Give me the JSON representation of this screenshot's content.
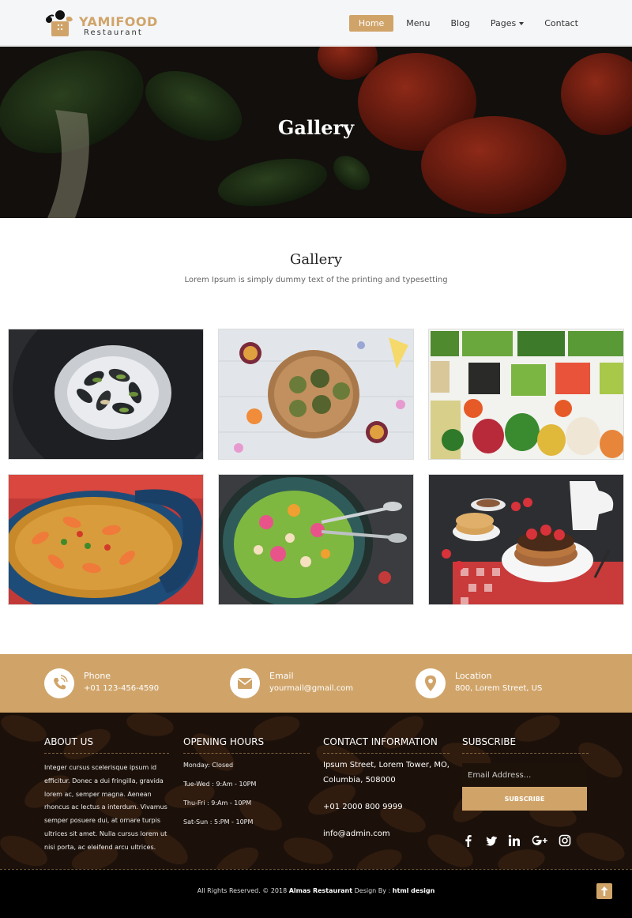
{
  "brand": {
    "name": "YAMIFOOD",
    "tagline": "Restaurant"
  },
  "nav": {
    "items": [
      {
        "label": "Home",
        "active": true
      },
      {
        "label": "Menu"
      },
      {
        "label": "Blog"
      },
      {
        "label": "Pages",
        "dropdown": true
      },
      {
        "label": "Contact"
      }
    ]
  },
  "hero": {
    "title": "Gallery"
  },
  "gallery": {
    "title": "Gallery",
    "subtitle": "Lorem Ipsum is simply dummy text of the printing and typesetting",
    "images": [
      "mussels-dish-photo",
      "passion-fruit-board-photo",
      "salad-bar-photo",
      "paella-photo",
      "green-salad-bowl-photo",
      "pancakes-strawberries-photo"
    ]
  },
  "contact_strip": {
    "phone": {
      "label": "Phone",
      "value": "+01 123-456-4590",
      "icon": "phone-icon"
    },
    "email": {
      "label": "Email",
      "value": "yourmail@gmail.com",
      "icon": "envelope-icon"
    },
    "location": {
      "label": "Location",
      "value": "800, Lorem Street, US",
      "icon": "map-marker-icon"
    }
  },
  "footer": {
    "about": {
      "heading": "ABOUT US",
      "text": "Integer cursus scelerisque ipsum id efficitur. Donec a dui fringilla, gravida lorem ac, semper magna. Aenean rhoncus ac lectus a interdum. Vivamus semper posuere dui, at ornare turpis ultrices sit amet. Nulla cursus lorem ut nisi porta, ac eleifend arcu ultrices."
    },
    "hours": {
      "heading": "OPENING HOURS",
      "lines": [
        "Monday: Closed",
        "Tue-Wed : 9:Am - 10PM",
        "Thu-Fri : 9:Am - 10PM",
        "Sat-Sun : 5:PM - 10PM"
      ]
    },
    "contact": {
      "heading": "CONTACT INFORMATION",
      "address_line1": "Ipsum Street, Lorem Tower, MO,",
      "address_line2": "Columbia, 508000",
      "phone": "+01 2000 800 9999",
      "email": "info@admin.com"
    },
    "subscribe": {
      "heading": "SUBSCRIBE",
      "placeholder": "Email Address...",
      "button": "SUBSCRIBE"
    },
    "social": [
      "facebook-icon",
      "twitter-icon",
      "linkedin-icon",
      "google-plus-icon",
      "instagram-icon"
    ]
  },
  "bottom": {
    "prefix": "All Rights Reserved. © 2018",
    "company": "Almas Restaurant",
    "middle": "Design By :",
    "designer": "html design"
  },
  "colors": {
    "accent": "#d0a469",
    "footer_bg": "#2a1a10",
    "bottom_bg": "#000000"
  }
}
